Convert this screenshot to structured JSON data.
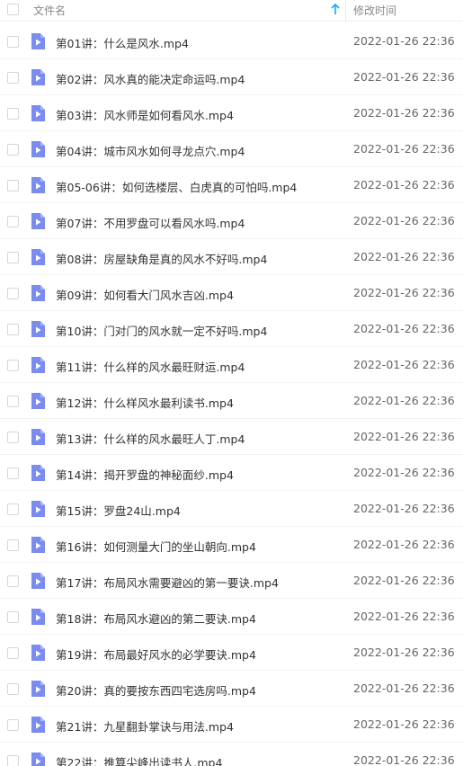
{
  "header": {
    "name_label": "文件名",
    "time_label": "修改时间",
    "sort_icon": "arrow-up-icon",
    "sort_color": "#09AAFF"
  },
  "icon_color": "#7B8CF0",
  "files": [
    {
      "name": "第01讲：什么是风水.mp4",
      "time": "2022-01-26 22:36"
    },
    {
      "name": "第02讲：风水真的能决定命运吗.mp4",
      "time": "2022-01-26 22:36"
    },
    {
      "name": "第03讲：风水师是如何看风水.mp4",
      "time": "2022-01-26 22:36"
    },
    {
      "name": "第04讲：城市风水如何寻龙点穴.mp4",
      "time": "2022-01-26 22:36"
    },
    {
      "name": "第05-06讲：如何选楼层、白虎真的可怕吗.mp4",
      "time": "2022-01-26 22:36"
    },
    {
      "name": "第07讲：不用罗盘可以看风水吗.mp4",
      "time": "2022-01-26 22:36"
    },
    {
      "name": "第08讲：房屋缺角是真的风水不好吗.mp4",
      "time": "2022-01-26 22:36"
    },
    {
      "name": "第09讲：如何看大门风水吉凶.mp4",
      "time": "2022-01-26 22:36"
    },
    {
      "name": "第10讲：门对门的风水就一定不好吗.mp4",
      "time": "2022-01-26 22:36"
    },
    {
      "name": "第11讲：什么样的风水最旺财运.mp4",
      "time": "2022-01-26 22:36"
    },
    {
      "name": "第12讲：什么样风水最利读书.mp4",
      "time": "2022-01-26 22:36"
    },
    {
      "name": "第13讲：什么样的风水最旺人丁.mp4",
      "time": "2022-01-26 22:36"
    },
    {
      "name": "第14讲：揭开罗盘的神秘面纱.mp4",
      "time": "2022-01-26 22:36"
    },
    {
      "name": "第15讲：罗盘24山.mp4",
      "time": "2022-01-26 22:36"
    },
    {
      "name": "第16讲：如何测量大门的坐山朝向.mp4",
      "time": "2022-01-26 22:36"
    },
    {
      "name": "第17讲：布局风水需要避凶的第一要诀.mp4",
      "time": "2022-01-26 22:36"
    },
    {
      "name": "第18讲：布局风水避凶的第二要诀.mp4",
      "time": "2022-01-26 22:36"
    },
    {
      "name": "第19讲：布局最好风水的必学要诀.mp4",
      "time": "2022-01-26 22:36"
    },
    {
      "name": "第20讲：真的要按东西四宅选房吗.mp4",
      "time": "2022-01-26 22:36"
    },
    {
      "name": "第21讲：九星翻卦掌诀与用法.mp4",
      "time": "2022-01-26 22:36"
    },
    {
      "name": "第22讲：推算尖峰出读书人.mp4",
      "time": "2022-01-26 22:36"
    }
  ]
}
